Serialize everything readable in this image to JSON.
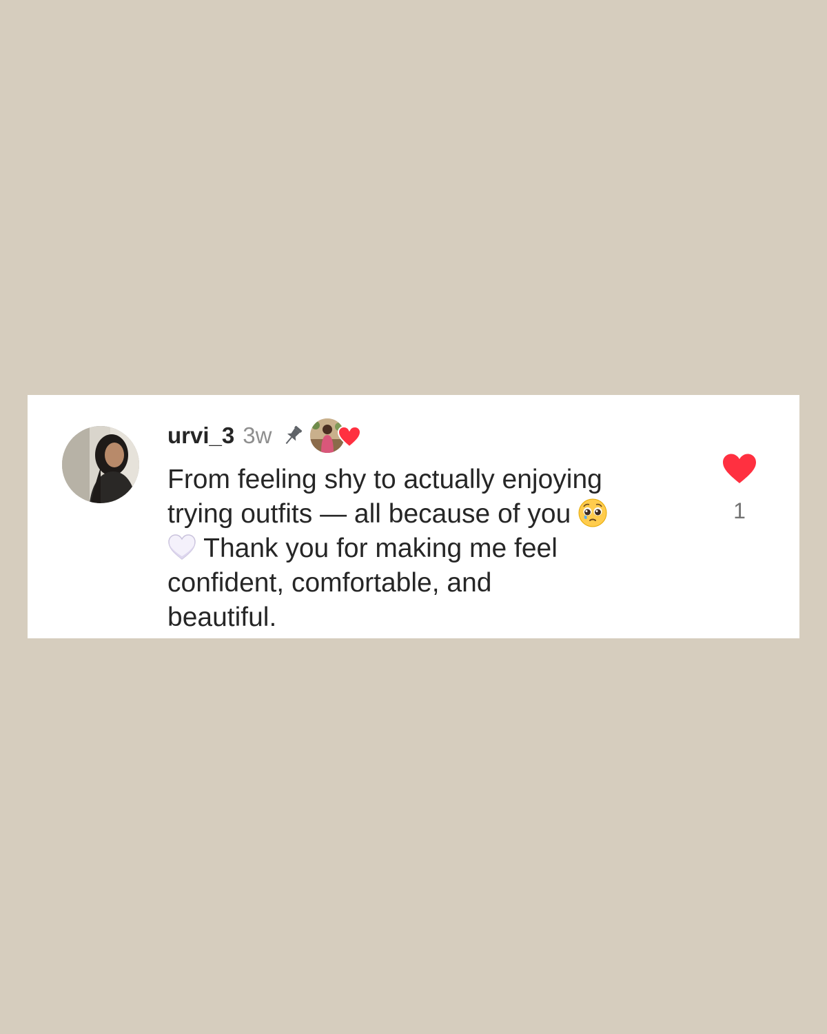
{
  "comment": {
    "avatar_icon": "user-avatar-photo",
    "username": "urvi_3",
    "timestamp": "3w",
    "pinned_icon": "pin-icon",
    "liked_by_author_icon": "author-avatar-with-heart",
    "lines": [
      "From feeling shy to actually enjoying",
      "trying outfits — all because of you",
      "Thank you for making me feel",
      "confident, comfortable, and",
      "beautiful."
    ],
    "emojis": [
      "pleading-face-emoji",
      "white-heart-emoji"
    ],
    "like_count": "1",
    "like_icon": "heart-icon",
    "like_color": "#ff3040"
  },
  "background_color": "#d6cdbe"
}
